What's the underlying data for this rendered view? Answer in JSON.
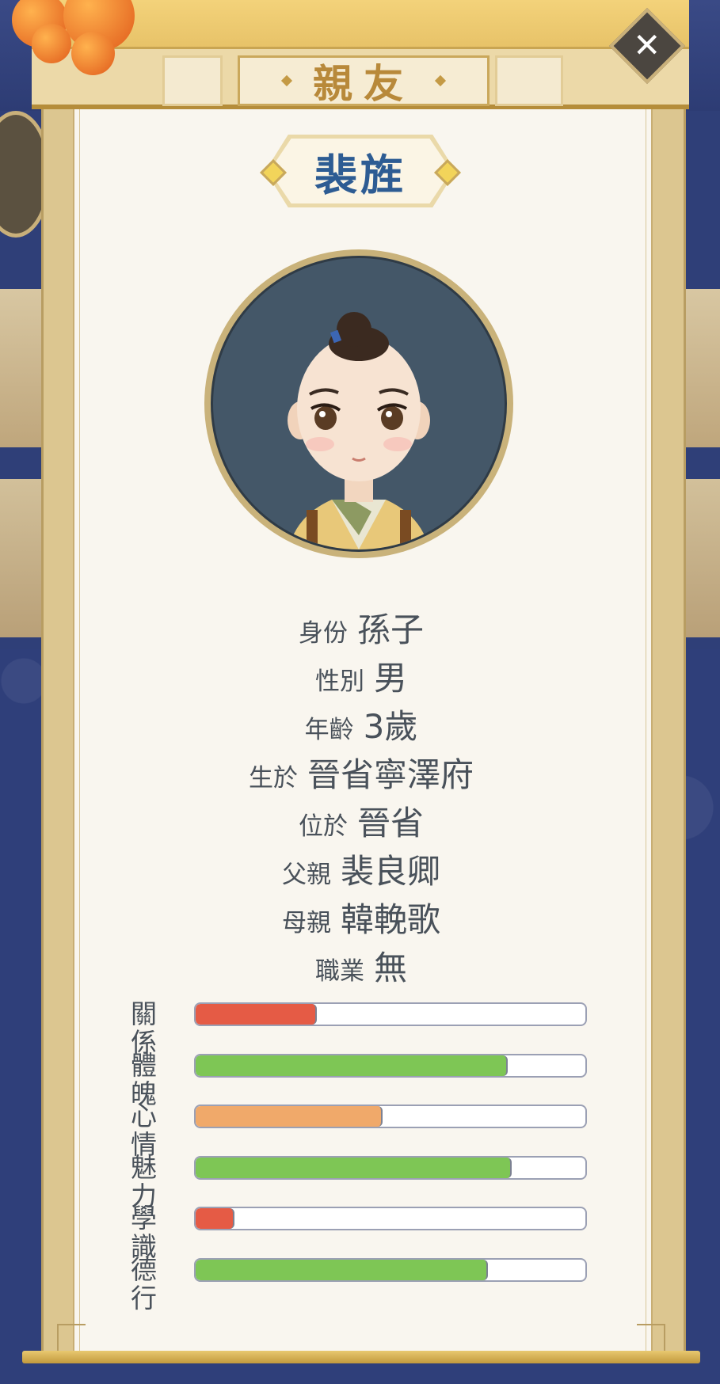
{
  "header": {
    "title": "親友"
  },
  "close_label": "✕",
  "person": {
    "name": "裴旌"
  },
  "info": [
    {
      "label": "身份",
      "value": "孫子"
    },
    {
      "label": "性別",
      "value": "男"
    },
    {
      "label": "年齡",
      "value": "3歲"
    },
    {
      "label": "生於",
      "value": "晉省寧澤府"
    },
    {
      "label": "位於",
      "value": "晉省"
    },
    {
      "label": "父親",
      "value": "裴良卿"
    },
    {
      "label": "母親",
      "value": "韓輓歌"
    },
    {
      "label": "職業",
      "value": "無"
    }
  ],
  "stats": [
    {
      "label": "關係",
      "level": 0.31,
      "color": "#e55b45"
    },
    {
      "label": "體魄",
      "level": 0.8,
      "color": "#7ec655"
    },
    {
      "label": "心情",
      "level": 0.48,
      "color": "#f0a96a"
    },
    {
      "label": "魅力",
      "level": 0.81,
      "color": "#7ec655"
    },
    {
      "label": "學識",
      "level": 0.1,
      "color": "#e55b45"
    },
    {
      "label": "德行",
      "level": 0.75,
      "color": "#7ec655"
    }
  ]
}
